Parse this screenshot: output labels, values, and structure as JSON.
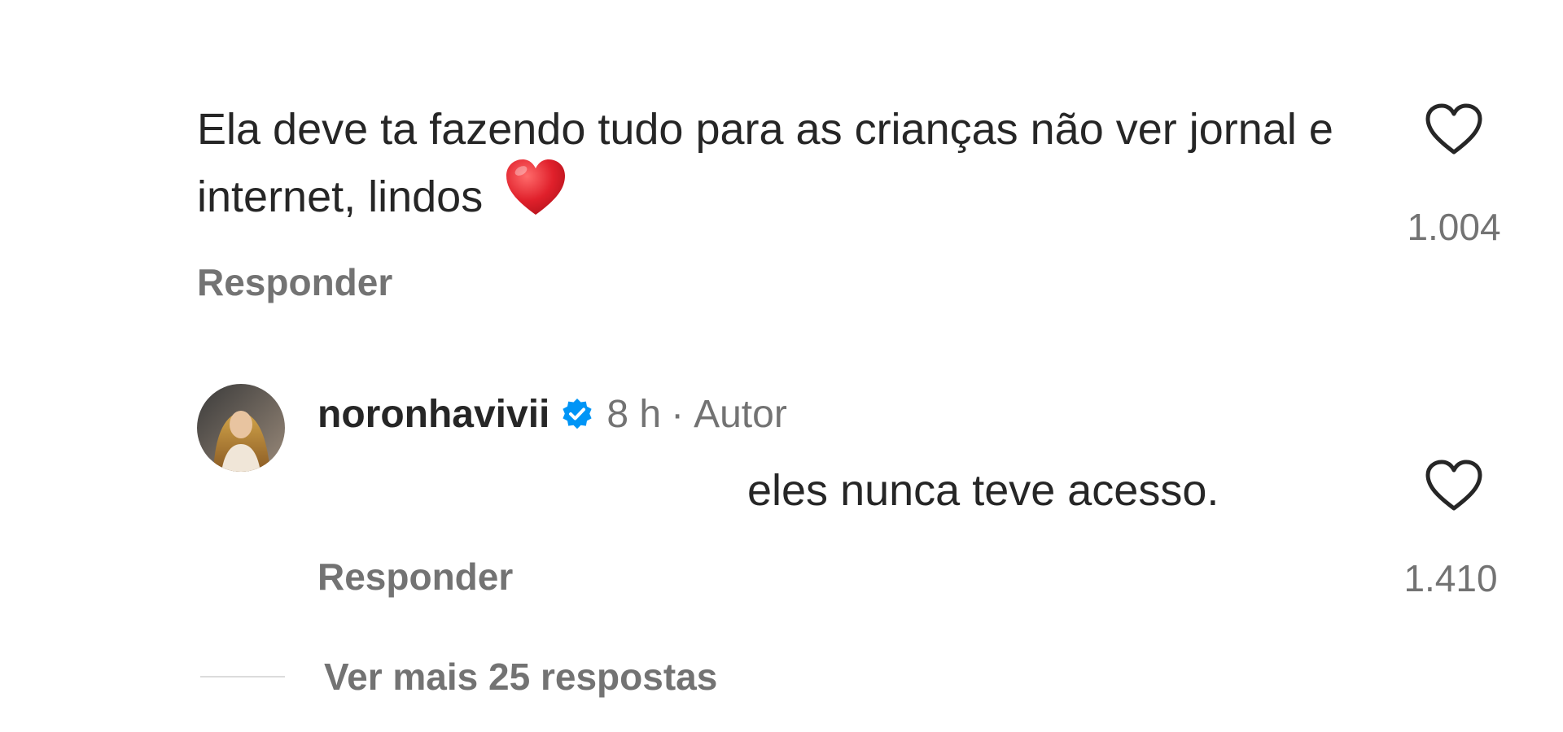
{
  "comment": {
    "text": "Ela deve ta fazendo tudo para as crianças não ver jornal e internet, lindos",
    "emoji": "red-heart-emoji",
    "like_count": "1.004",
    "reply_label": "Responder"
  },
  "reply": {
    "username": "noronhavivii",
    "verified": true,
    "time": "8 h",
    "separator": "·",
    "author_tag": "Autor",
    "text": "eles nunca teve acesso.",
    "like_count": "1.410",
    "reply_label": "Responder"
  },
  "view_more": {
    "label": "Ver mais 25 respostas"
  },
  "colors": {
    "text": "#262626",
    "muted": "#737373",
    "verified_blue": "#0095f6",
    "heart_red": "#ed2b3a"
  }
}
